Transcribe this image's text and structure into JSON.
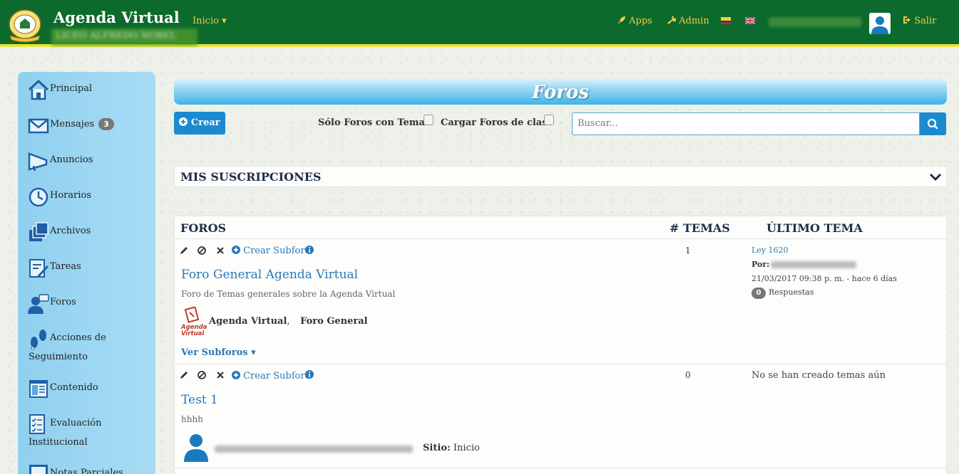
{
  "header": {
    "brand": "Agenda Virtual",
    "school": "LICEO ALFREDO NOBEL",
    "nav_inicio": "Inicio ▾",
    "apps": "Apps",
    "admin": "Admin",
    "salir": "Salir"
  },
  "sidebar": {
    "items": [
      {
        "label": "Principal"
      },
      {
        "label": "Mensajes",
        "badge": "3"
      },
      {
        "label": "Anuncios"
      },
      {
        "label": "Horarios"
      },
      {
        "label": "Archivos"
      },
      {
        "label": "Tareas"
      },
      {
        "label": "Foros"
      },
      {
        "label": "Acciones de",
        "label2": "Seguimiento"
      },
      {
        "label": "Contenido"
      },
      {
        "label": "Evaluación",
        "label2": "Institucional"
      },
      {
        "label": "Notas Parciales"
      }
    ]
  },
  "main": {
    "banner_title": "Foros",
    "crear_label": "Crear",
    "filter_only_topics": "Sólo Foros con Temas",
    "filter_class_forums": "Cargar Foros de clase",
    "search_placeholder": "Buscar...",
    "subscriptions_title": "MIS SUSCRIPCIONES",
    "table": {
      "col_foros": "FOROS",
      "col_temas": "# TEMAS",
      "col_ultimo": "ÚLTIMO TEMA"
    },
    "forums": [
      {
        "create_subforum": "Crear Subforo",
        "title": "Foro General Agenda Virtual",
        "description": "Foro de Temas generales sobre la Agenda Virtual",
        "tag1": "Agenda Virtual",
        "tag_sep": ",",
        "tag2": "Foro General",
        "ver_subforos": "Ver Subforos ▾",
        "topic_count": "1",
        "last_topic": "Ley 1620",
        "by_label": "Por:",
        "date": "21/03/2017 09:38 p. m. - hace 6 días",
        "responses_count": "0",
        "responses_label": "Respuestas"
      },
      {
        "create_subforum": "Crear Subforo",
        "title": "Test 1",
        "description": "hhhh",
        "site_label": "Sitio:",
        "site_value": "Inicio",
        "topic_count": "0",
        "no_topics": "No se han creado temas aún"
      }
    ]
  },
  "colors": {
    "header_bg": "#0b6a2c",
    "header_accent": "#e8e43a",
    "primary_button": "#1a8bd1",
    "sidebar_bg": "#a9dcf5",
    "link": "#2b78b7"
  }
}
